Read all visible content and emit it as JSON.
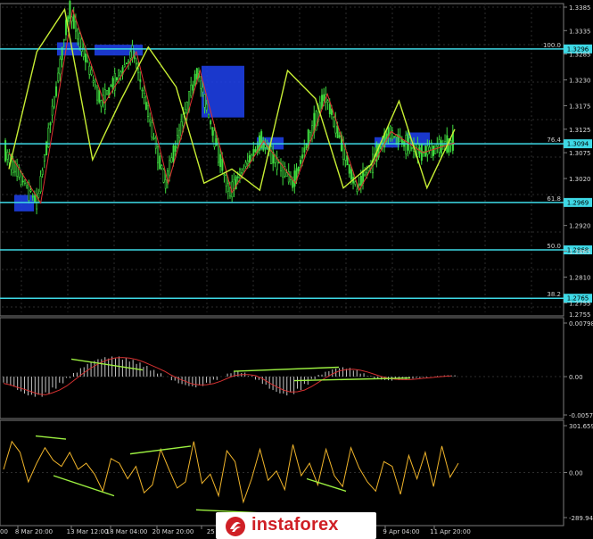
{
  "chart_data": [
    {
      "type": "candlestick",
      "price_ylim": [
        1.2735,
        1.3385
      ],
      "y_tick_labels": [
        "1.3385",
        "1.3335",
        "1.3285",
        "1.3230",
        "1.3175",
        "1.3125",
        "1.3075",
        "1.3020",
        "1.2920",
        "1.2865",
        "1.2810",
        "1.2755"
      ],
      "y_tick_values": [
        1.3385,
        1.3335,
        1.3285,
        1.323,
        1.3175,
        1.3125,
        1.3075,
        1.302,
        1.292,
        1.2865,
        1.281,
        1.2755
      ],
      "fib_levels": [
        {
          "pct": "100.0",
          "price": 1.3296,
          "label": "1.3296"
        },
        {
          "pct": "76.4",
          "price": 1.3094,
          "label": "1.3094"
        },
        {
          "pct": "61.8",
          "price": 1.2969,
          "label": "1.2969"
        },
        {
          "pct": "50.0",
          "price": 1.2868,
          "label": "1.2868"
        },
        {
          "pct": "38.2",
          "price": 1.2765,
          "label": "1.2765"
        }
      ],
      "x_tick_labels": [
        "8 Mar 20:00",
        "13 Mar 12:00",
        "18 Mar 04:00",
        "20 Mar 20:00",
        "25 Mar",
        "9 Apr 04:00",
        "11 Apr 20:00"
      ],
      "left_edge_label": "00",
      "bottom_axis_label": "1.2755",
      "zigzag_red": [
        1.3075,
        1.2968,
        1.338,
        1.318,
        1.329,
        1.301,
        1.325,
        1.299,
        1.31,
        1.301,
        1.32,
        1.2995,
        1.312,
        1.3075,
        1.3096
      ],
      "zigzag_green": [
        1.304,
        1.329,
        1.338,
        1.306,
        1.3185,
        1.33,
        1.3215,
        1.301,
        1.304,
        1.2995,
        1.325,
        1.319,
        1.3,
        1.305,
        1.3185,
        1.3,
        1.3125
      ]
    },
    {
      "type": "histogram",
      "name": "MACD",
      "ylim": [
        -0.00571,
        0.00798
      ],
      "tick_labels": [
        "0.00798",
        "0.00",
        "-0.00571"
      ],
      "tick_values": [
        0.00798,
        0.0,
        -0.00571
      ],
      "values": [
        -0.001,
        -0.0015,
        -0.0022,
        -0.0028,
        -0.003,
        -0.003,
        -0.0026,
        -0.0018,
        -0.001,
        -0.0002,
        0.0006,
        0.0014,
        0.0021,
        0.0026,
        0.0029,
        0.003,
        0.003,
        0.0028,
        0.0025,
        0.0021,
        0.0016,
        0.001,
        0.0005,
        0.0,
        -0.0006,
        -0.0011,
        -0.0014,
        -0.0016,
        -0.0014,
        -0.001,
        -0.0005,
        0.0,
        0.0005,
        0.0008,
        0.0006,
        0.0001,
        -0.0005,
        -0.0012,
        -0.002,
        -0.0025,
        -0.0028,
        -0.0026,
        -0.002,
        -0.0012,
        -0.0004,
        0.0003,
        0.0008,
        0.0012,
        0.0014,
        0.0013,
        0.001,
        0.0005,
        0.0001,
        -0.0003,
        -0.0005,
        -0.0006,
        -0.0005,
        -0.0004,
        -0.0003,
        -0.0002,
        -0.0001,
        0.0,
        0.0001,
        0.0002,
        0.0002
      ]
    },
    {
      "type": "line",
      "name": "Oscillator",
      "ylim": [
        -289.948,
        301.6597
      ],
      "tick_labels": [
        "301.6597",
        "0.00",
        "-289.948"
      ],
      "tick_values": [
        301.6597,
        0.0,
        -289.948
      ],
      "values": [
        20,
        200,
        130,
        -60,
        60,
        160,
        80,
        40,
        130,
        20,
        60,
        -10,
        -120,
        90,
        60,
        -40,
        40,
        -130,
        -80,
        150,
        20,
        -100,
        -60,
        200,
        -70,
        -10,
        -150,
        140,
        70,
        -190,
        -40,
        150,
        -50,
        10,
        -110,
        180,
        -20,
        60,
        -80,
        150,
        -20,
        -90,
        160,
        30,
        -60,
        -120,
        70,
        40,
        -140,
        110,
        -40,
        130,
        -90,
        170,
        -30,
        60
      ]
    }
  ]
}
